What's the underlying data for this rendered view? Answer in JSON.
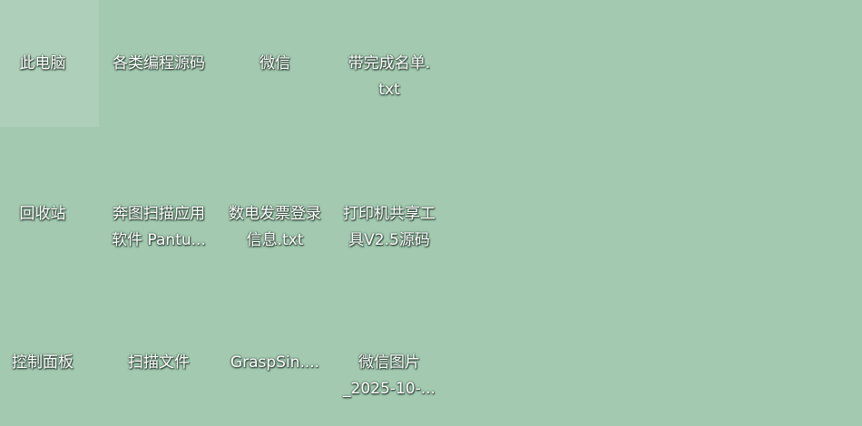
{
  "desktop": {
    "icons": [
      {
        "name": "此电脑",
        "lines": [
          "此电脑"
        ]
      },
      {
        "name": "各类编程源码",
        "lines": [
          "各类编程源码"
        ]
      },
      {
        "name": "微信",
        "lines": [
          "微信"
        ]
      },
      {
        "name": "带完成名单.txt",
        "lines": [
          "带完成名单.",
          "txt"
        ]
      },
      {
        "name": "回收站",
        "lines": [
          "回收站"
        ]
      },
      {
        "name": "奔图扫描应用软件 Pantu...",
        "lines": [
          "奔图扫描应用",
          "软件 Pantu..."
        ]
      },
      {
        "name": "数电发票登录信息.txt",
        "lines": [
          "数电发票登录",
          "信息.txt"
        ]
      },
      {
        "name": "打印机共享工具V2.5源码",
        "lines": [
          "打印机共享工",
          "具V2.5源码"
        ]
      },
      {
        "name": "控制面板",
        "lines": [
          "控制面板"
        ]
      },
      {
        "name": "扫描文件",
        "lines": [
          "扫描文件"
        ]
      },
      {
        "name": "GraspSin....",
        "lines": [
          "GraspSin...."
        ]
      },
      {
        "name": "微信图片_2025-10-...",
        "lines": [
          "微信图片",
          "_2025-10-..."
        ]
      }
    ]
  },
  "colors": {
    "wallpaper": "#a3c9b0",
    "label_text": "#ffffff"
  }
}
